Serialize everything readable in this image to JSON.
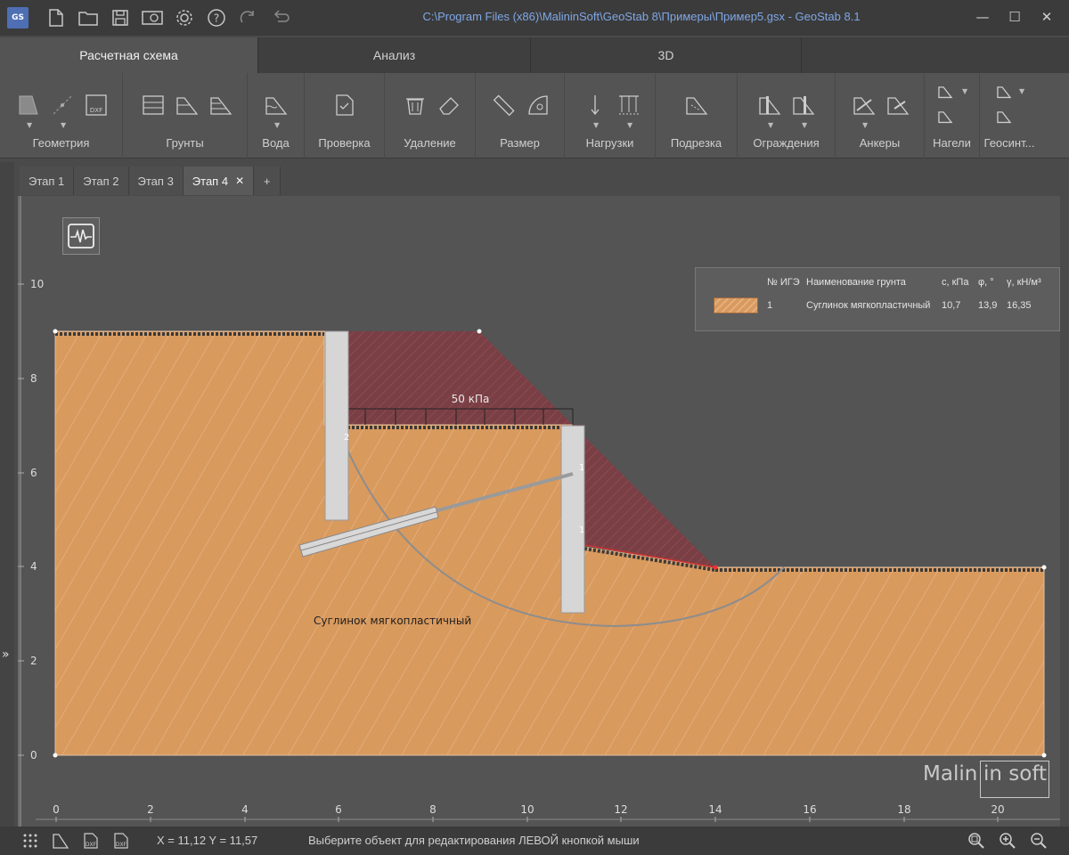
{
  "window": {
    "title": "C:\\Program Files (x86)\\MalininSoft\\GeoStab 8\\Примеры\\Пример5.gsx - GeoStab 8.1",
    "logo": "GS",
    "title_icons": [
      "new-file-icon",
      "open-folder-icon",
      "save-icon",
      "export-image-icon",
      "settings-gear-icon",
      "help-icon",
      "redo-icon",
      "undo-icon"
    ],
    "controls": {
      "minimize": "—",
      "maximize": "☐",
      "close": "✕"
    }
  },
  "ribbon_tabs": [
    {
      "label": "Расчетная схема",
      "active": true
    },
    {
      "label": "Анализ",
      "active": false
    },
    {
      "label": "3D",
      "active": false
    }
  ],
  "ribbon_groups": [
    {
      "label": "Геометрия"
    },
    {
      "label": "Грунты"
    },
    {
      "label": "Вода"
    },
    {
      "label": "Проверка"
    },
    {
      "label": "Удаление"
    },
    {
      "label": "Размер"
    },
    {
      "label": "Нагрузки"
    },
    {
      "label": "Подрезка"
    },
    {
      "label": "Ограждения"
    },
    {
      "label": "Анкеры"
    },
    {
      "label": "Нагели"
    },
    {
      "label": "Геосинт..."
    }
  ],
  "ribbon_dxf_label": "DXF",
  "stages": [
    {
      "label": "Этап 1",
      "active": false
    },
    {
      "label": "Этап 2",
      "active": false
    },
    {
      "label": "Этап 3",
      "active": false
    },
    {
      "label": "Этап 4",
      "active": true
    }
  ],
  "stage_close": "✕",
  "stage_add": "+",
  "expand_glyph": "»",
  "legend": {
    "headers": {
      "num": "№ ИГЭ",
      "name": "Наименование грунта",
      "c": "c, кПа",
      "phi": "φ, °",
      "gamma": "γ, кН/м³"
    },
    "rows": [
      {
        "num": "1",
        "name": "Суглинок мягкопластичный",
        "c": "10,7",
        "phi": "13,9",
        "gamma": "16,35",
        "color": "#d99a5e"
      }
    ]
  },
  "drawing": {
    "soil_label": "Суглинок мягкопластичный",
    "load_label": "50 кПа",
    "wall_label_1": "2",
    "wall_label_2": "1",
    "wall_label_3": "1",
    "x_ticks": [
      "0",
      "2",
      "4",
      "6",
      "8",
      "10",
      "12",
      "14",
      "16",
      "18",
      "20"
    ],
    "y_ticks": [
      "0",
      "2",
      "4",
      "6",
      "8",
      "10"
    ],
    "soil_color": "#d99a5e",
    "cut_color": "#7a3f45"
  },
  "brand": {
    "left": "Malin",
    "right": "in soft"
  },
  "status": {
    "coord": "X = 11,12  Y = 11,57",
    "hint": "Выберите объект для редактирования ЛЕВОЙ кнопкой мыши",
    "icons": [
      "grid-icon",
      "polygon-icon",
      "dxf-import-icon",
      "dxf-export-icon",
      "zoom-fit-icon",
      "zoom-in-icon",
      "zoom-out-icon"
    ]
  }
}
